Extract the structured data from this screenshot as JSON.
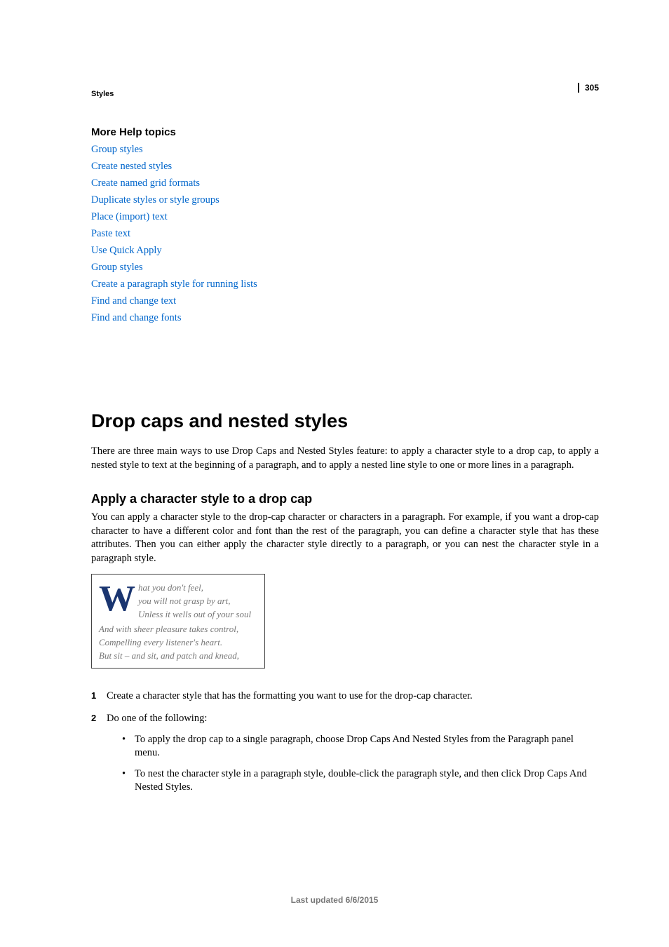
{
  "page_number": "305",
  "breadcrumb": "Styles",
  "more_help": {
    "heading": "More Help topics",
    "links": [
      "Group styles",
      "Create nested styles",
      "Create named grid formats",
      "Duplicate styles or style groups",
      "Place (import) text",
      "Paste text",
      "Use Quick Apply",
      "Group styles",
      "Create a paragraph style for running lists",
      "Find and change text",
      "Find and change fonts"
    ]
  },
  "main_heading": "Drop caps and nested styles",
  "intro": "There are three main ways to use Drop Caps and Nested Styles feature: to apply a character style to a drop cap, to apply a nested style to text at the beginning of a paragraph, and to apply a nested line style to one or more lines in a paragraph.",
  "sub_heading": "Apply a character style to a drop cap",
  "sub_body": "You can apply a character style to the drop-cap character or characters in a paragraph. For example, if you want a drop-cap character to have a different color and font than the rest of the paragraph, you can define a character style that has these attributes. Then you can either apply the character style directly to a paragraph, or you can nest the character style in a paragraph style.",
  "illustration": {
    "dropcap": "W",
    "line1": "hat you don't feel,",
    "line2": "you will not grasp by art,",
    "line3": "Unless it wells out of your soul",
    "line4": "And with sheer pleasure takes control,",
    "line5": "Compelling every listener's heart.",
    "line6": "But sit – and sit, and patch and knead,"
  },
  "steps": {
    "s1": "Create a character style that has the formatting you want to use for the drop-cap character.",
    "s2": "Do one of the following:",
    "s2_bullets": [
      "To apply the drop cap to a single paragraph, choose Drop Caps And Nested Styles from the Paragraph panel menu.",
      "To nest the character style in a paragraph style, double-click the paragraph style, and then click Drop Caps And Nested Styles."
    ]
  },
  "footer": "Last updated 6/6/2015"
}
